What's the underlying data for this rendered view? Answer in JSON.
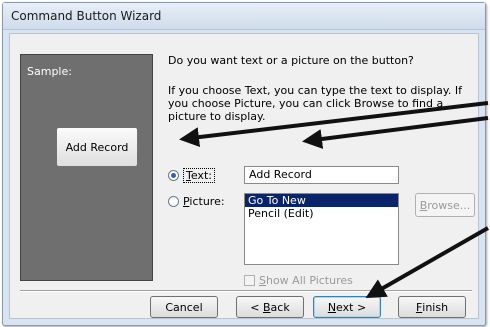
{
  "window": {
    "title": "Command Button Wizard"
  },
  "sample": {
    "label": "Sample:",
    "button_label": "Add Record"
  },
  "prompt": {
    "question": "Do you want text or a picture on the button?",
    "explanation": "If you choose Text, you can type the text to display.  If you choose Picture, you can click Browse to find a picture to display."
  },
  "options": {
    "text": {
      "label": "Text:",
      "mnemonic": "T",
      "rest": "ext:",
      "selected": true,
      "value": "Add Record"
    },
    "picture": {
      "label": "Picture:",
      "mnemonic": "P",
      "rest": "icture:",
      "selected": false
    },
    "pictures": [
      "Go To New",
      "Pencil (Edit)"
    ],
    "selected_picture": "Go To New",
    "browse": {
      "label": "Browse...",
      "mnemonic": "B",
      "rest": "rowse..."
    },
    "show_all": {
      "label": "Show All Pictures",
      "mnemonic": "S",
      "rest": "how All Pictures"
    }
  },
  "footer": {
    "cancel": "Cancel",
    "back": {
      "label": "< Back",
      "prefix": "< ",
      "mnemonic": "B",
      "rest": "ack"
    },
    "next": {
      "label": "Next >",
      "mnemonic": "N",
      "rest": "ext >"
    },
    "finish": {
      "label": "Finish",
      "mnemonic": "F",
      "rest": "inish"
    }
  },
  "colors": {
    "selection": "#0a246a",
    "annotation_arrow": "#111111",
    "sample_panel": "#6f6f6f"
  }
}
